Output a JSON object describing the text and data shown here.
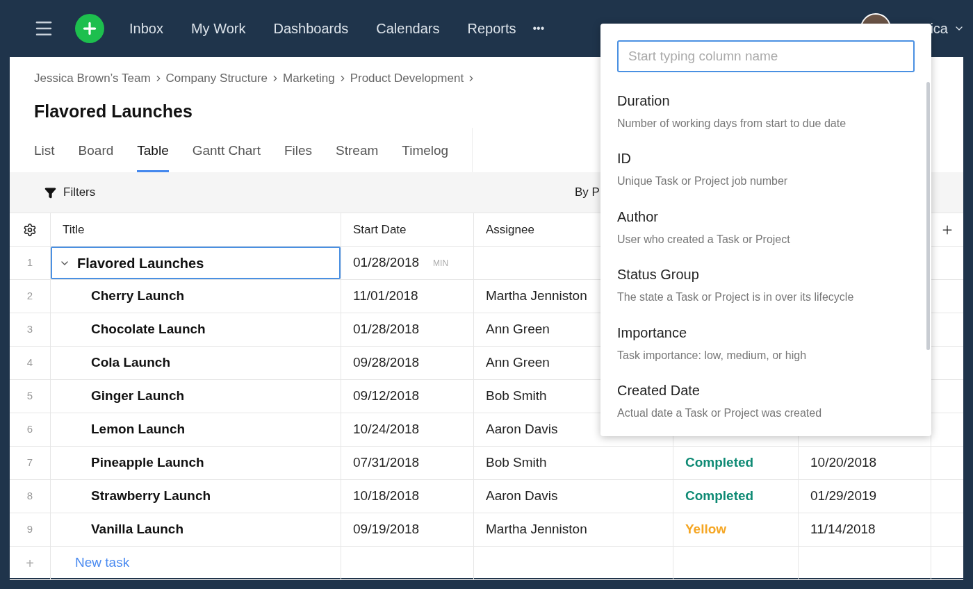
{
  "nav": {
    "items": [
      "Inbox",
      "My Work",
      "Dashboards",
      "Calendars",
      "Reports"
    ],
    "more": "•••",
    "user_name": "ica"
  },
  "breadcrumb": [
    "Jessica Brown’s Team",
    "Company Structure",
    "Marketing",
    "Product Development"
  ],
  "title": "Flavored Launches",
  "tabs": [
    {
      "label": "List",
      "selected": false
    },
    {
      "label": "Board",
      "selected": false
    },
    {
      "label": "Table",
      "selected": true
    },
    {
      "label": "Gantt Chart",
      "selected": false
    },
    {
      "label": "Files",
      "selected": false
    },
    {
      "label": "Stream",
      "selected": false
    },
    {
      "label": "Timelog",
      "selected": false
    }
  ],
  "toolbar": {
    "filters": "Filters",
    "group_by": "By P"
  },
  "table": {
    "columns": [
      "Title",
      "Start Date",
      "Assignee"
    ],
    "rows": [
      {
        "number": "1",
        "title": "Flavored Launches",
        "start_date": "01/28/2018",
        "start_note": "MIN",
        "selected": true,
        "expanded": true,
        "children": [
          {
            "number": "2",
            "title": "Cherry Launch",
            "start_date": "11/01/2018",
            "assignee": "Martha Jenniston",
            "selected": false
          },
          {
            "number": "3",
            "title": "Chocolate Launch",
            "start_date": "01/28/2018",
            "assignee": "Ann Green",
            "selected": false
          },
          {
            "number": "4",
            "title": "Cola Launch",
            "start_date": "09/28/2018",
            "assignee": "Ann Green",
            "selected": false
          },
          {
            "number": "5",
            "title": "Ginger Launch",
            "start_date": "09/12/2018",
            "assignee": "Bob Smith",
            "selected": false
          },
          {
            "number": "6",
            "title": "Lemon Launch",
            "start_date": "10/24/2018",
            "assignee": "Aaron Davis",
            "selected": false
          },
          {
            "number": "7",
            "title": "Pineapple Launch",
            "start_date": "07/31/2018",
            "assignee": "Bob Smith",
            "status": {
              "text": "Completed",
              "color": "#0e8a74"
            },
            "column_5": "10/20/2018",
            "selected": false
          },
          {
            "number": "8",
            "title": "Strawberry Launch",
            "start_date": "10/18/2018",
            "assignee": "Aaron Davis",
            "status": {
              "text": "Completed",
              "color": "#0e8a74"
            },
            "column_5": "01/29/2019",
            "selected": false
          },
          {
            "number": "9",
            "title": "Vanilla Launch",
            "start_date": "09/19/2018",
            "assignee": "Martha Jenniston",
            "status": {
              "text": "Yellow",
              "color": "#f5a623"
            },
            "column_5": "11/14/2018",
            "selected": false
          }
        ]
      }
    ],
    "new_task": {
      "symbol": "+",
      "label": "New task"
    }
  },
  "column_picker": {
    "placeholder": "Start typing column name",
    "options": [
      {
        "name": "Duration",
        "description": "Number of working days from start to due date"
      },
      {
        "name": "ID",
        "description": "Unique Task or Project job number"
      },
      {
        "name": "Author",
        "description": "User who created a Task or Project"
      },
      {
        "name": "Status Group",
        "description": "The state a Task or Project is in over its lifecycle"
      },
      {
        "name": "Importance",
        "description": "Task importance: low, medium, or high"
      },
      {
        "name": "Created Date",
        "description": "Actual date a Task or Project was created"
      }
    ]
  }
}
